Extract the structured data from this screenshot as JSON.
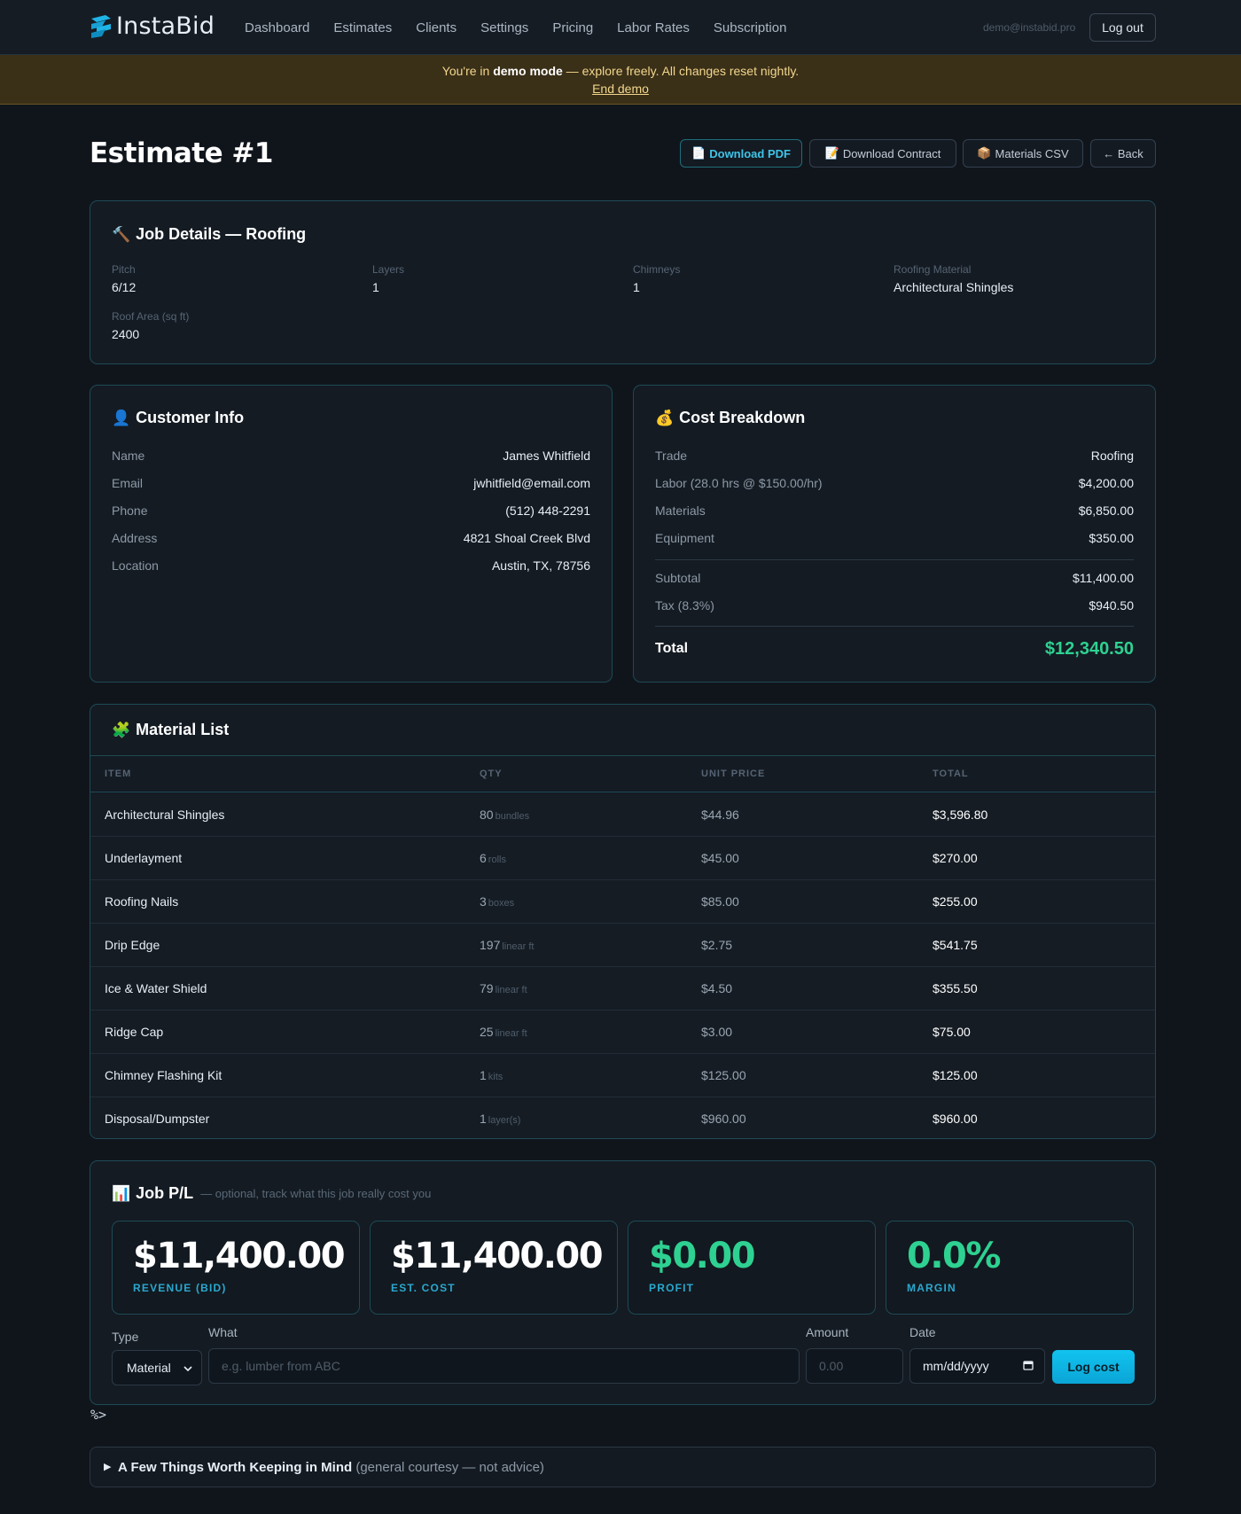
{
  "app": {
    "name": "InstaBid"
  },
  "nav": {
    "links": [
      "Dashboard",
      "Estimates",
      "Clients",
      "Settings",
      "Pricing",
      "Labor Rates",
      "Subscription"
    ],
    "user_email": "demo@instabid.pro",
    "logout_label": "Log out"
  },
  "demo_banner": {
    "prefix": "You're in ",
    "bold": "demo mode",
    "suffix": " — explore freely. All changes reset nightly.",
    "end_link": "End demo"
  },
  "header": {
    "title": "Estimate #1",
    "buttons": {
      "download_pdf": "Download PDF",
      "download_contract": "Download Contract",
      "materials_csv": "Materials CSV",
      "back": "← Back"
    }
  },
  "job_details": {
    "title": "Job Details — Roofing",
    "fields": [
      {
        "label": "Pitch",
        "value": "6/12"
      },
      {
        "label": "Layers",
        "value": "1"
      },
      {
        "label": "Chimneys",
        "value": "1"
      },
      {
        "label": "Roofing Material",
        "value": "Architectural Shingles"
      },
      {
        "label": "Roof Area (sq ft)",
        "value": "2400"
      }
    ]
  },
  "customer": {
    "title": "Customer Info",
    "rows": [
      {
        "key": "Name",
        "value": "James Whitfield"
      },
      {
        "key": "Email",
        "value": "jwhitfield@email.com"
      },
      {
        "key": "Phone",
        "value": "(512) 448-2291"
      },
      {
        "key": "Address",
        "value": "4821 Shoal Creek Blvd"
      },
      {
        "key": "Location",
        "value": "Austin, TX, 78756"
      }
    ]
  },
  "cost": {
    "title": "Cost Breakdown",
    "rows": [
      {
        "key": "Trade",
        "value": "Roofing"
      },
      {
        "key": "Labor (28.0 hrs @ $150.00/hr)",
        "value": "$4,200.00"
      },
      {
        "key": "Materials",
        "value": "$6,850.00"
      },
      {
        "key": "Equipment",
        "value": "$350.00"
      }
    ],
    "subtotal": {
      "key": "Subtotal",
      "value": "$11,400.00"
    },
    "tax": {
      "key": "Tax (8.3%)",
      "value": "$940.50"
    },
    "total": {
      "key": "Total",
      "value": "$12,340.50"
    },
    "colors": {
      "total": "#2ed191"
    }
  },
  "materials": {
    "title": "Material List",
    "columns": [
      "ITEM",
      "QTY",
      "UNIT PRICE",
      "TOTAL"
    ],
    "rows": [
      {
        "item": "Architectural Shingles",
        "qty": "80",
        "unit": "bundles",
        "unit_price": "$44.96",
        "total": "$3,596.80"
      },
      {
        "item": "Underlayment",
        "qty": "6",
        "unit": "rolls",
        "unit_price": "$45.00",
        "total": "$270.00"
      },
      {
        "item": "Roofing Nails",
        "qty": "3",
        "unit": "boxes",
        "unit_price": "$85.00",
        "total": "$255.00"
      },
      {
        "item": "Drip Edge",
        "qty": "197",
        "unit": "linear ft",
        "unit_price": "$2.75",
        "total": "$541.75"
      },
      {
        "item": "Ice & Water Shield",
        "qty": "79",
        "unit": "linear ft",
        "unit_price": "$4.50",
        "total": "$355.50"
      },
      {
        "item": "Ridge Cap",
        "qty": "25",
        "unit": "linear ft",
        "unit_price": "$3.00",
        "total": "$75.00"
      },
      {
        "item": "Chimney Flashing Kit",
        "qty": "1",
        "unit": "kits",
        "unit_price": "$125.00",
        "total": "$125.00"
      },
      {
        "item": "Disposal/Dumpster",
        "qty": "1",
        "unit": "layer(s)",
        "unit_price": "$960.00",
        "total": "$960.00"
      }
    ]
  },
  "pl": {
    "title": "Job P/L",
    "subtitle": "— optional, track what this job really cost you",
    "stats": [
      {
        "value": "$11,400.00",
        "label": "REVENUE (BID)"
      },
      {
        "value": "$11,400.00",
        "label": "EST. COST"
      },
      {
        "value": "$0.00",
        "label": "PROFIT"
      },
      {
        "value": "0.0%",
        "label": "MARGIN"
      }
    ],
    "form": {
      "type_label": "Type",
      "type_value": "Material",
      "what_label": "What",
      "what_placeholder": "e.g. lumber from ABC",
      "amount_label": "Amount",
      "amount_placeholder": "0.00",
      "date_label": "Date",
      "date_placeholder": "mm/dd/yyyy",
      "submit_label": "Log cost"
    }
  },
  "stray_text": "%>",
  "disclosure": {
    "title": "A Few Things Worth Keeping in Mind",
    "subtitle": "(general courtesy — not advice)"
  },
  "colors": {
    "accent": "#12c3ef",
    "positive": "#2ed191",
    "banner_bg": "#3a2f17"
  },
  "icons": {
    "logo": "instabid-logo-icon",
    "pdf": "page-icon",
    "contract": "memo-icon",
    "csv": "package-icon",
    "job": "hammer-icon",
    "customer": "person-icon",
    "cost": "money-bag-icon",
    "materials": "puzzle-icon",
    "pl": "bar-chart-icon"
  }
}
